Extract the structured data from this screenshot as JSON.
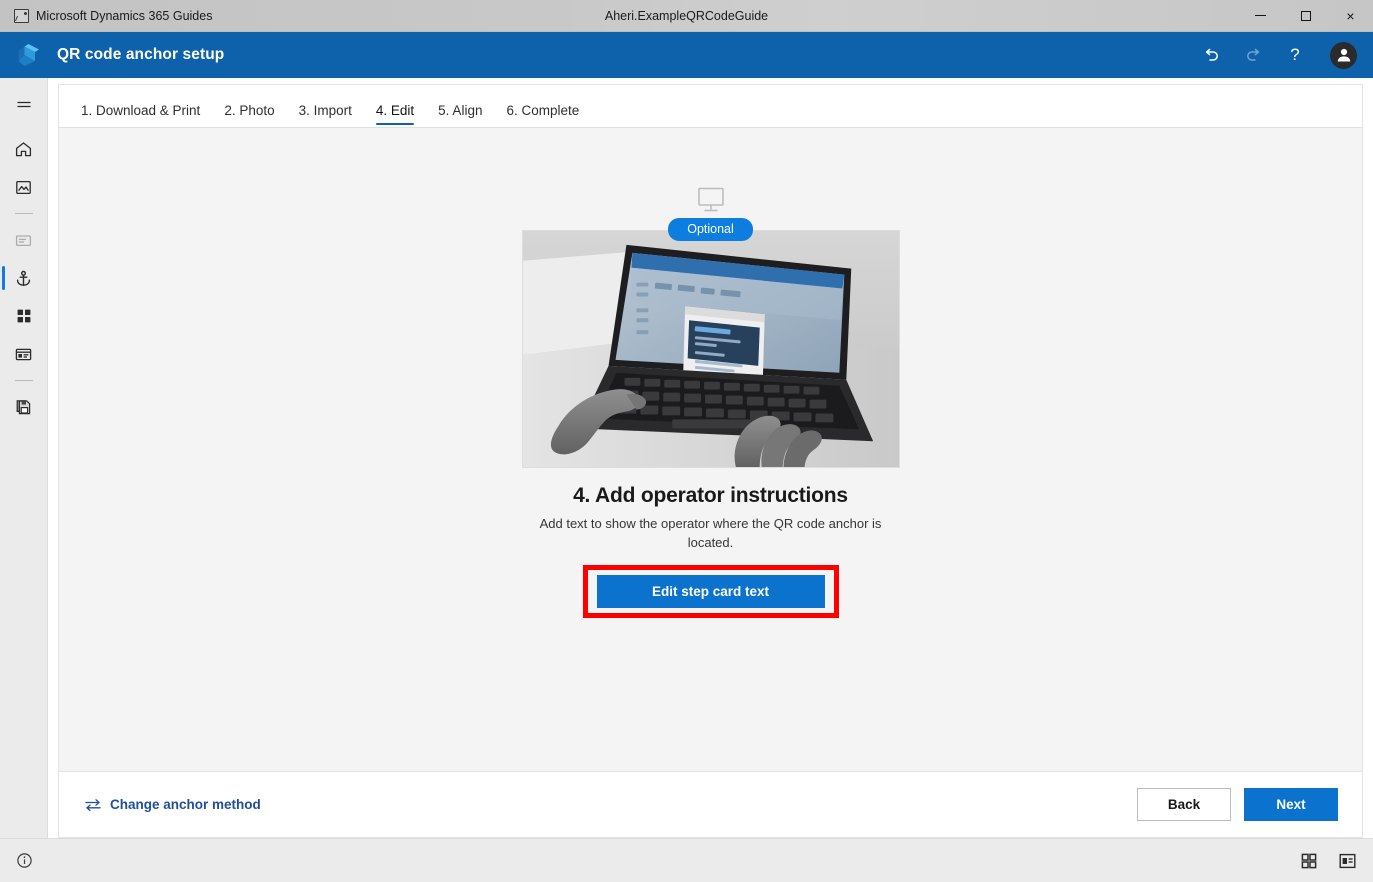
{
  "window": {
    "app_icon": "app-photo-icon",
    "app_name": "Microsoft Dynamics 365 Guides",
    "document_title": "Aheri.ExampleQRCodeGuide",
    "controls": {
      "minimize": "minimize-button",
      "maximize": "maximize-button",
      "close": "×"
    }
  },
  "header": {
    "logo": "dynamics-365-guides-logo",
    "title": "QR code anchor setup",
    "actions": [
      {
        "name": "undo-button",
        "icon": "undo-icon",
        "state": "enabled"
      },
      {
        "name": "redo-button",
        "icon": "redo-icon",
        "state": "disabled"
      },
      {
        "name": "help-button",
        "icon": "question-mark-icon",
        "label": "?"
      }
    ],
    "account": {
      "name": "account-avatar",
      "icon": "person-icon"
    }
  },
  "sidebar": {
    "items": [
      {
        "name": "menu-toggle",
        "icon": "hamburger-menu-icon",
        "active": false,
        "disabled": false
      },
      {
        "name": "home",
        "icon": "home-icon",
        "active": false,
        "disabled": false
      },
      {
        "name": "media-gallery",
        "icon": "image-icon",
        "active": false,
        "disabled": false
      },
      {
        "name": "step-card",
        "icon": "card-icon",
        "active": false,
        "disabled": true
      },
      {
        "name": "anchor",
        "icon": "anchor-icon",
        "active": true,
        "disabled": false
      },
      {
        "name": "parts-grid",
        "icon": "grid-icon",
        "active": false,
        "disabled": false
      },
      {
        "name": "step-editor",
        "icon": "step-panel-icon",
        "active": false,
        "disabled": false
      },
      {
        "name": "save-copy",
        "icon": "save-icon",
        "active": false,
        "disabled": false
      }
    ]
  },
  "tabs": {
    "items": [
      {
        "label": "1. Download & Print",
        "active": false
      },
      {
        "label": "2. Photo",
        "active": false
      },
      {
        "label": "3. Import",
        "active": false
      },
      {
        "label": "4. Edit",
        "active": true
      },
      {
        "label": "5. Align",
        "active": false
      },
      {
        "label": "6. Complete",
        "active": false
      }
    ]
  },
  "content": {
    "device_icon": "desktop-monitor-icon",
    "badge": "Optional",
    "illustration": "photo-hands-typing-on-laptop",
    "step_title": "4. Add operator instructions",
    "step_description": "Add text to show the operator where the QR code anchor is located.",
    "cta_label": "Edit step card text",
    "highlight_color": "#fe0000"
  },
  "footer": {
    "change_anchor_icon": "swap-arrows-icon",
    "change_anchor_label": "Change anchor method",
    "back_label": "Back",
    "next_label": "Next"
  },
  "statusbar": {
    "info_icon": "info-circle-icon",
    "view_icons": [
      {
        "name": "grid-view-icon"
      },
      {
        "name": "card-view-icon"
      }
    ]
  },
  "colors": {
    "header_blue": "#0d62ab",
    "accent_blue": "#0d7ee0",
    "button_blue": "#0b72cd",
    "link_blue": "#1f4e9c",
    "highlight_red": "#fe0000"
  }
}
